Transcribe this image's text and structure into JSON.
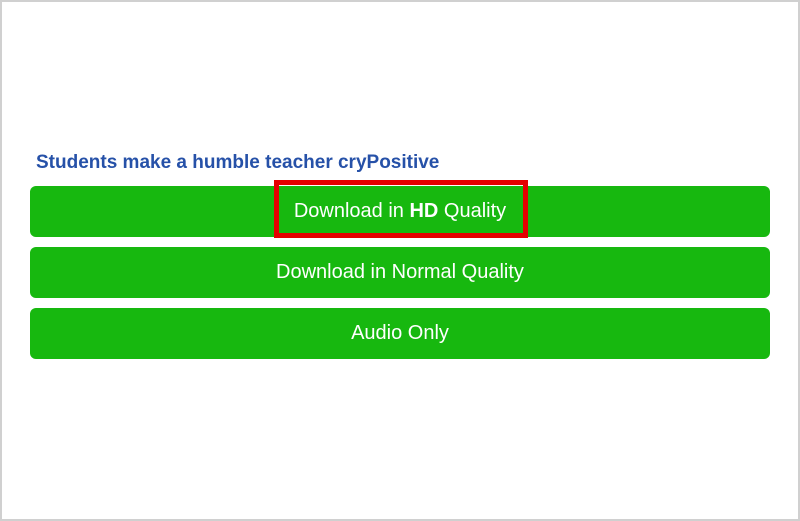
{
  "title": "Students make a humble teacher cryPositive",
  "buttons": {
    "hd": {
      "prefix": "Download in ",
      "bold": "HD",
      "suffix": " Quality"
    },
    "normal": "Download in Normal Quality",
    "audio": "Audio Only"
  }
}
